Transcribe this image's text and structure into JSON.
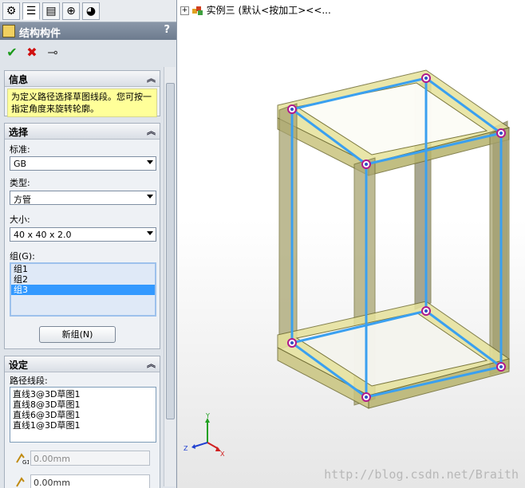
{
  "tree": {
    "root_label": "实例三 (默认<按加工><<..."
  },
  "panel": {
    "title": "结构构件",
    "help": "?",
    "tabs": [
      "feature-manager-icon",
      "property-manager-icon",
      "configuration-manager-icon",
      "dimxpert-icon",
      "display-manager-icon"
    ],
    "info": {
      "header": "信息",
      "text": "为定义路径选择草图线段。您可按一指定角度来旋转轮廓。"
    },
    "selection": {
      "header": "选择",
      "standard_label": "标准:",
      "standard_value": "GB",
      "type_label": "类型:",
      "type_value": "方管",
      "size_label": "大小:",
      "size_value": "40 x 40 x 2.0",
      "groups_label": "组(G):",
      "groups": [
        "组1",
        "组2",
        "组3"
      ],
      "selected_group": "组3",
      "new_group_button": "新组(N)"
    },
    "settings": {
      "header": "设定",
      "path_label": "路径线段:",
      "paths": [
        "直线3@3D草图1",
        "直线8@3D草图1",
        "直线6@3D草图1",
        "直线1@3D草图1"
      ],
      "field1_value": "0.00mm",
      "field1_icon_label": "G1",
      "field2_value": "0.00mm"
    }
  },
  "triad": {
    "x": "X",
    "y": "Y",
    "z": "Z"
  },
  "watermark": "http://blog.csdn.net/Braith",
  "colors": {
    "frame_fill": "#e8e6a0",
    "frame_edge": "#7a7a3a",
    "path_line": "#3aa0f0",
    "node": "#b0198c"
  }
}
